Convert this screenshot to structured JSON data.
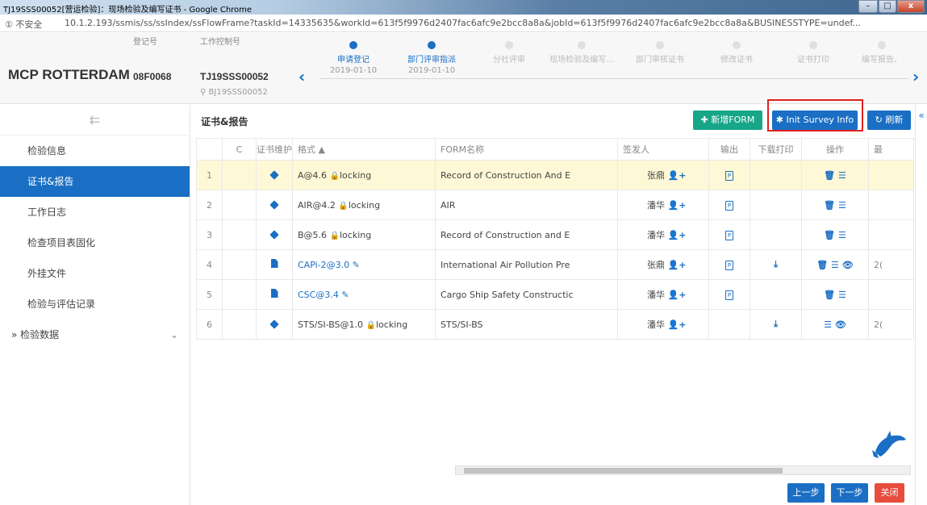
{
  "window": {
    "title": "TJ19SSS00052[营运检验]：现场检验及编写证书 - Google Chrome",
    "controls": {
      "minimize": "–",
      "maximize": "□",
      "close": "x"
    }
  },
  "address_bar": {
    "security_label": "① 不安全",
    "url": "10.1.2.193/ssmis/ss/ssIndex/ssFlowFrame?taskId=14335635&workId=613f5f9976d2407fac6afc9e2bcc8a8a&jobId=613f5f9976d2407fac6afc9e2bcc8a8a&BUSINESSTYPE=undef..."
  },
  "header": {
    "brand": "MCP ROTTERDAM",
    "reg_label": "登记号",
    "reg_value": "08F0068",
    "ctrl_label": "工作控制号",
    "ctrl_value": "TJ19SSS00052",
    "ctrl_sub": "BJ19SSS00052",
    "steps": [
      {
        "label": "申请登记",
        "date": "2019-01-10",
        "state": "done"
      },
      {
        "label": "部门评审指派",
        "date": "2019-01-10",
        "state": "done"
      },
      {
        "label": "分社评审",
        "date": "",
        "state": "todo"
      },
      {
        "label": "现场检验及编写...",
        "date": "",
        "state": "current"
      },
      {
        "label": "部门审核证书",
        "date": "",
        "state": "todo"
      },
      {
        "label": "修改证书",
        "date": "",
        "state": "todo"
      },
      {
        "label": "证书打印",
        "date": "",
        "state": "todo"
      },
      {
        "label": "编写报告、",
        "date": "",
        "state": "todo"
      }
    ]
  },
  "sidebar": {
    "items": [
      {
        "label": "检验信息",
        "active": false
      },
      {
        "label": "证书&报告",
        "active": true
      },
      {
        "label": "工作日志",
        "active": false
      },
      {
        "label": "检查项目表固化",
        "active": false
      },
      {
        "label": "外挂文件",
        "active": false
      },
      {
        "label": "检验与评估记录",
        "active": false
      }
    ],
    "group": {
      "prefix": "»",
      "label": "检验数据",
      "chevron": "⌄"
    }
  },
  "main": {
    "title": "证书&报告",
    "buttons": {
      "add_form": "新增FORM",
      "init_survey": "Init Survey Info",
      "refresh": "刷新",
      "prev": "上一步",
      "next": "下一步",
      "close": "关闭"
    },
    "table": {
      "headers": [
        "",
        "C",
        "证书维护",
        "格式 ▲",
        "FORM名称",
        "签发人",
        "输出",
        "下载打印",
        "操作",
        "最"
      ],
      "rows": [
        {
          "no": "1",
          "icon": "tag-icon",
          "format": "A@4.6",
          "lock": "locking",
          "form": "Record of Construction And E",
          "signer": "张鼎",
          "pdf": true,
          "download": false,
          "ops": "🗑 ☰",
          "extra": ""
        },
        {
          "no": "2",
          "icon": "tag-icon",
          "format": "AIR@4.2",
          "lock": "locking",
          "form": "AIR",
          "signer": "潘华",
          "pdf": true,
          "download": false,
          "ops": "🗑 ☰",
          "extra": ""
        },
        {
          "no": "3",
          "icon": "tag-icon",
          "format": "B@5.6",
          "lock": "locking",
          "form": "Record of Construction and E",
          "signer": "潘华",
          "pdf": true,
          "download": false,
          "ops": "🗑 ☰",
          "extra": ""
        },
        {
          "no": "4",
          "icon": "file-icon",
          "format": "CAPi-2@3.0",
          "lock": "",
          "form": "International Air Pollution Pre",
          "signer": "张鼎",
          "pdf": true,
          "download": true,
          "ops": "🗑 ☰ 👁",
          "extra": "2("
        },
        {
          "no": "5",
          "icon": "file-icon",
          "format": "CSC@3.4",
          "lock": "",
          "form": "Cargo Ship Safety Constructic",
          "signer": "潘华",
          "pdf": true,
          "download": false,
          "ops": "🗑 ☰",
          "extra": ""
        },
        {
          "no": "6",
          "icon": "tag-icon",
          "format": "STS/SI-BS@1.0",
          "lock": "locking",
          "form": "STS/SI-BS",
          "signer": "潘华",
          "pdf": false,
          "download": true,
          "ops": "☰ 👁",
          "extra": "2("
        }
      ]
    }
  },
  "colors": {
    "accent": "#1a6fc4",
    "green": "#18a689",
    "red": "#e84c3d",
    "highlight_box": "#e02020",
    "row_highlight": "#fff8d6"
  }
}
